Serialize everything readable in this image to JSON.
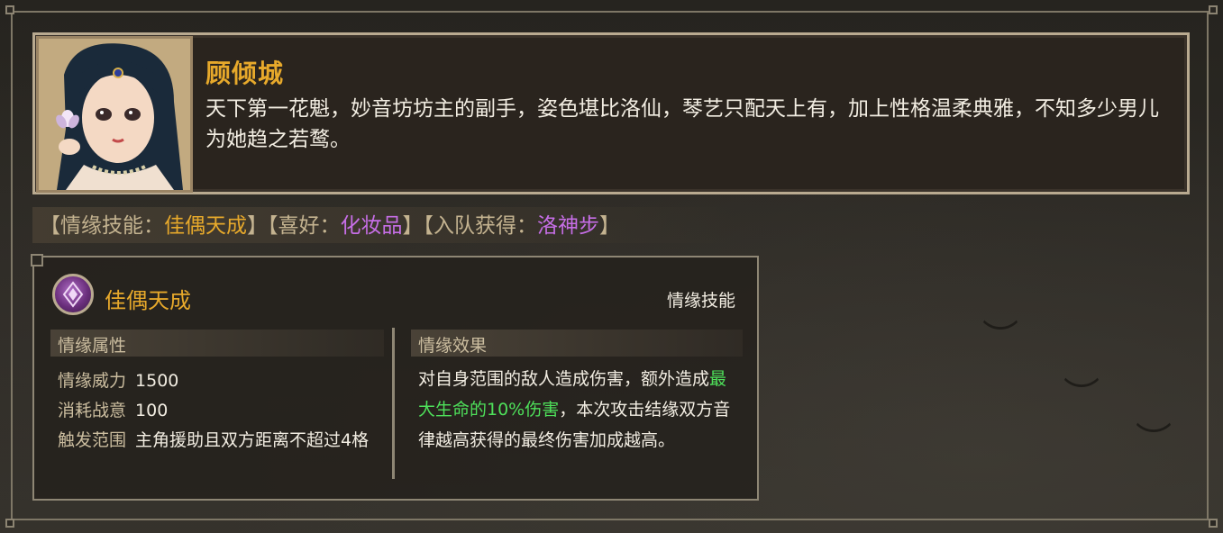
{
  "character": {
    "name": "顾倾城",
    "description": "天下第一花魁，妙音坊坊主的副手，姿色堪比洛仙，琴艺只配天上有，加上性格温柔典雅，不知多少男儿为她趋之若鹜。"
  },
  "tags": {
    "skill_prefix": "【情缘技能：",
    "skill_value": "佳偶天成",
    "hobby_prefix": "】【喜好：",
    "hobby_value": "化妆品",
    "join_prefix": "】【入队获得：",
    "join_value": "洛神步",
    "suffix": "】"
  },
  "skill": {
    "title": "佳偶天成",
    "type": "情缘技能",
    "attributes_header": "情缘属性",
    "attributes": [
      {
        "label": "情缘威力",
        "value": "1500"
      },
      {
        "label": "消耗战意",
        "value": "100"
      },
      {
        "label": "触发范围",
        "value": "主角援助且双方距离不超过4格"
      }
    ],
    "effect_header": "情缘效果",
    "effect_part1": "对自身范围的敌人造成伤害，额外造成",
    "effect_highlight": "最大生命的10%伤害",
    "effect_part2": "，本次攻击结缘双方音律越高获得的最终伤害加成越高。"
  },
  "colors": {
    "name_gold": "#e7a92b",
    "hobby_purple": "#c66ee6",
    "highlight_green": "#4ee05a",
    "border": "#b9aa90"
  },
  "icons": {
    "portrait": "character-portrait",
    "skill": "skill-gem-icon"
  }
}
